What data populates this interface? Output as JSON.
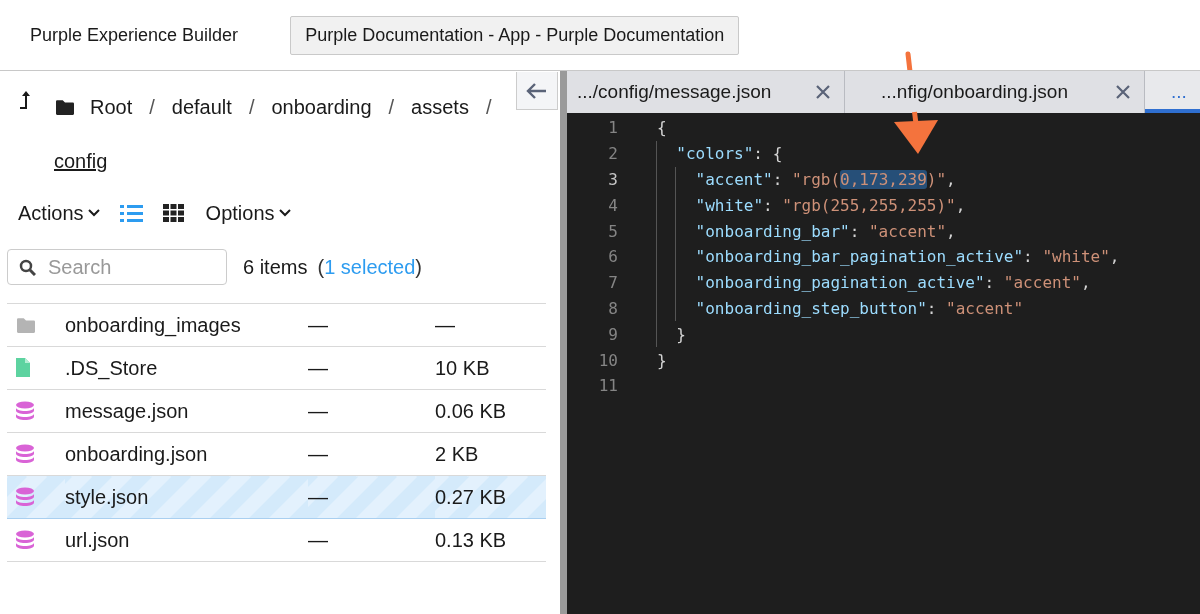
{
  "top_bar": {
    "app_title": "Purple Experience Builder",
    "app_button": "Purple Documentation - App - Purple Documentation"
  },
  "browser": {
    "breadcrumbs": [
      {
        "label": "Root",
        "current": false
      },
      {
        "label": "default",
        "current": false
      },
      {
        "label": "onboarding",
        "current": false
      },
      {
        "label": "assets",
        "current": false
      },
      {
        "label": "config",
        "current": true
      }
    ],
    "separator": "/",
    "toolbar": {
      "actions": "Actions",
      "options": "Options",
      "views": [
        {
          "kind": "list",
          "selected": true
        },
        {
          "kind": "grid",
          "selected": false
        }
      ]
    },
    "search": {
      "placeholder": "Search"
    },
    "summary": {
      "count": "6 items",
      "open": "(",
      "selected_link": "1 selected",
      "close": ")"
    },
    "files": [
      {
        "kind": "folder",
        "name": "onboarding_images",
        "modified": "—",
        "size": "—",
        "selected": false
      },
      {
        "kind": "file",
        "name": ".DS_Store",
        "modified": "—",
        "size": "10 KB",
        "selected": false
      },
      {
        "kind": "data",
        "name": "message.json",
        "modified": "—",
        "size": "0.06 KB",
        "selected": false
      },
      {
        "kind": "data",
        "name": "onboarding.json",
        "modified": "—",
        "size": "2 KB",
        "selected": false
      },
      {
        "kind": "data",
        "name": "style.json",
        "modified": "—",
        "size": "0.27 KB",
        "selected": true
      },
      {
        "kind": "data",
        "name": "url.json",
        "modified": "—",
        "size": "0.13 KB",
        "selected": false
      }
    ]
  },
  "editor": {
    "tabs": [
      {
        "label": ".../config/message.json",
        "selected": false,
        "closable": true
      },
      {
        "label": "...nfig/onboarding.json",
        "selected": false,
        "closable": true
      },
      {
        "label": "...",
        "selected": true,
        "closable": false
      }
    ],
    "lines": [
      {
        "number": "1",
        "current": false,
        "tokens": [
          {
            "kind": "punct",
            "text": "{"
          }
        ]
      },
      {
        "number": "2",
        "current": false,
        "tokens": [
          {
            "kind": "indent"
          },
          {
            "kind": "key",
            "text": "\"colors\""
          },
          {
            "kind": "punct",
            "text": ": {"
          }
        ]
      },
      {
        "number": "3",
        "current": true,
        "tokens": [
          {
            "kind": "indent"
          },
          {
            "kind": "indent"
          },
          {
            "kind": "key",
            "text": "\"accent\""
          },
          {
            "kind": "punct",
            "text": ": "
          },
          {
            "kind": "string",
            "text": "\"rgb("
          },
          {
            "kind": "string",
            "text": "0,173,239",
            "highlighted": true
          },
          {
            "kind": "string",
            "text": ")\""
          },
          {
            "kind": "punct",
            "text": ","
          }
        ]
      },
      {
        "number": "4",
        "current": false,
        "tokens": [
          {
            "kind": "indent"
          },
          {
            "kind": "indent"
          },
          {
            "kind": "key",
            "text": "\"white\""
          },
          {
            "kind": "punct",
            "text": ": "
          },
          {
            "kind": "string",
            "text": "\"rgb(255,255,255)\""
          },
          {
            "kind": "punct",
            "text": ","
          }
        ]
      },
      {
        "number": "5",
        "current": false,
        "tokens": [
          {
            "kind": "indent"
          },
          {
            "kind": "indent"
          },
          {
            "kind": "key",
            "text": "\"onboarding_bar\""
          },
          {
            "kind": "punct",
            "text": ": "
          },
          {
            "kind": "string",
            "text": "\"accent\""
          },
          {
            "kind": "punct",
            "text": ","
          }
        ]
      },
      {
        "number": "6",
        "current": false,
        "tokens": [
          {
            "kind": "indent"
          },
          {
            "kind": "indent"
          },
          {
            "kind": "key",
            "text": "\"onboarding_bar_pagination_active\""
          },
          {
            "kind": "punct",
            "text": ": "
          },
          {
            "kind": "string",
            "text": "\"white\""
          },
          {
            "kind": "punct",
            "text": ","
          }
        ]
      },
      {
        "number": "7",
        "current": false,
        "tokens": [
          {
            "kind": "indent"
          },
          {
            "kind": "indent"
          },
          {
            "kind": "key",
            "text": "\"onboarding_pagination_active\""
          },
          {
            "kind": "punct",
            "text": ": "
          },
          {
            "kind": "string",
            "text": "\"accent\""
          },
          {
            "kind": "punct",
            "text": ","
          }
        ]
      },
      {
        "number": "8",
        "current": false,
        "tokens": [
          {
            "kind": "indent"
          },
          {
            "kind": "indent"
          },
          {
            "kind": "key",
            "text": "\"onboarding_step_button\""
          },
          {
            "kind": "punct",
            "text": ": "
          },
          {
            "kind": "string",
            "text": "\"accent\""
          }
        ]
      },
      {
        "number": "9",
        "current": false,
        "tokens": [
          {
            "kind": "indent"
          },
          {
            "kind": "punct",
            "text": "}"
          }
        ]
      },
      {
        "number": "10",
        "current": false,
        "tokens": [
          {
            "kind": "punct",
            "text": "}"
          }
        ]
      },
      {
        "number": "11",
        "current": false
      }
    ]
  }
}
